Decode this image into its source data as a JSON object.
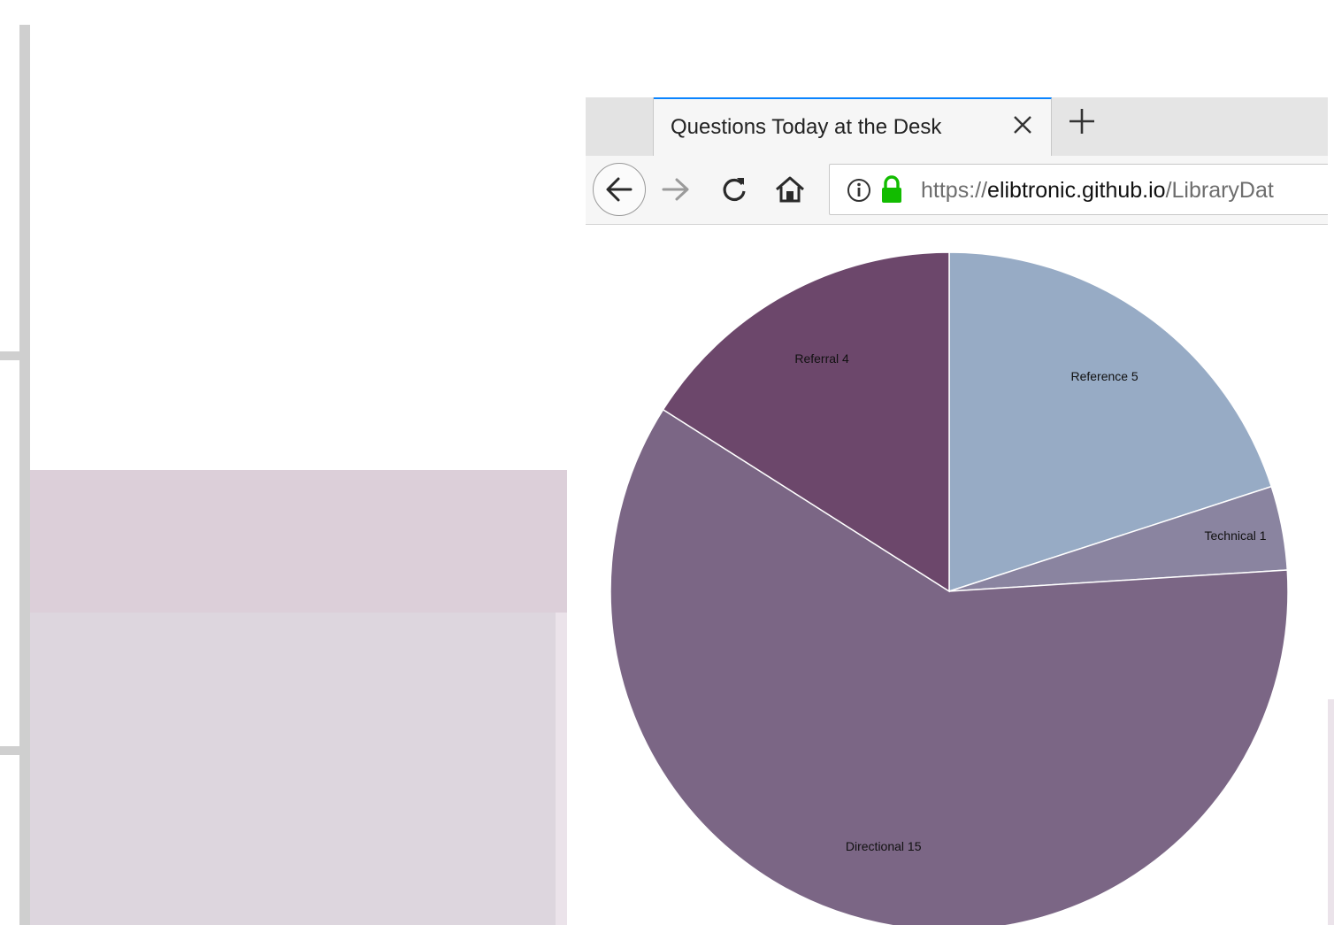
{
  "browser": {
    "tab_title": "Questions Today at the Desk",
    "close_icon": "close-icon",
    "new_tab_icon": "plus-icon",
    "url": {
      "scheme": "https://",
      "host": "elibtronic.github.io",
      "path": "/LibraryDat"
    }
  },
  "chart_data": {
    "type": "pie",
    "slices": [
      {
        "label": "Reference 5",
        "category": "Reference",
        "value": 5,
        "color": "#97abc5"
      },
      {
        "label": "Technical 1",
        "category": "Technical",
        "value": 1,
        "color": "#8a84a0"
      },
      {
        "label": "Directional 15",
        "category": "Directional",
        "value": 15,
        "color": "#7b6685"
      },
      {
        "label": "Referral 4",
        "category": "Referral",
        "value": 4,
        "color": "#6c476b"
      }
    ]
  },
  "colors": {
    "tab_accent": "#0a84ff",
    "lock_green": "#12bc00"
  }
}
